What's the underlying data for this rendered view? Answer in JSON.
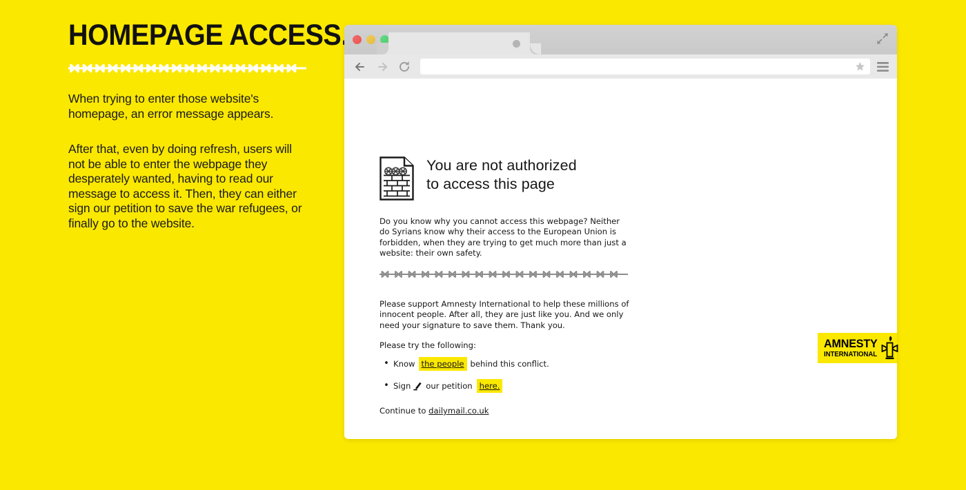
{
  "theme": {
    "background_yellow": "#FBE800",
    "text_black": "#161616",
    "wire_white": "#FFFFFF",
    "wire_gray": "#8C8C8C"
  },
  "left_panel": {
    "headline": "HOMEPAGE ACCESS.",
    "divider_icon": "barbed-wire-divider",
    "paragraph_1": "When trying to enter those website's homepage, an error message appears.",
    "paragraph_2": "After that, even by doing refresh, users will not be able to enter the webpage they desperately wanted, having to read our message to access it. Then, they can either sign our petition to save the war refugees, or finally go to the website."
  },
  "browser": {
    "traffic_lights": [
      {
        "name": "close",
        "color": "#E9564F"
      },
      {
        "name": "minimize",
        "color": "#E4BB3C"
      },
      {
        "name": "maximize",
        "color": "#4CCD6C"
      }
    ],
    "tab": {
      "title": "",
      "close_icon": "tab-close-dot"
    },
    "fullscreen_icon": "expand-arrows-icon",
    "toolbar": {
      "back_icon": "arrow-left-icon",
      "forward_icon": "arrow-right-icon",
      "reload_icon": "reload-icon",
      "bookmark_icon": "star-icon",
      "menu_icon": "hamburger-menu-icon",
      "url_value": "",
      "url_placeholder": ""
    }
  },
  "error_page": {
    "icon": "blocked-page-brick-wall-icon",
    "title_line_1": "You are not authorized",
    "title_line_2": "to access this page",
    "paragraph_1": "Do you know why you cannot access this webpage? Neither do Syrians know why their access to the European Union is forbidden, when they are trying to get much more than just a website: their own safety.",
    "divider_icon": "barbed-wire-divider",
    "paragraph_2": "Please support Amnesty International to help these millions of innocent people. After all, they are just like you. And we only need your signature to save them. Thank you.",
    "paragraph_3": "Please try the following:",
    "bullets": [
      {
        "prefix": "Know",
        "link": "the people",
        "suffix": "behind this conflict.",
        "icon": null
      },
      {
        "prefix": "Sign",
        "link": "here.",
        "suffix": "our petition",
        "icon": "pen-signature-icon"
      }
    ],
    "continue_prefix": "Continue to",
    "continue_link": "dailymail.co.uk"
  },
  "amnesty_logo": {
    "line_1": "AMNESTY",
    "line_2": "INTERNATIONAL",
    "emblem_icon": "candle-barbed-wire-icon",
    "background": "#FBE800"
  }
}
